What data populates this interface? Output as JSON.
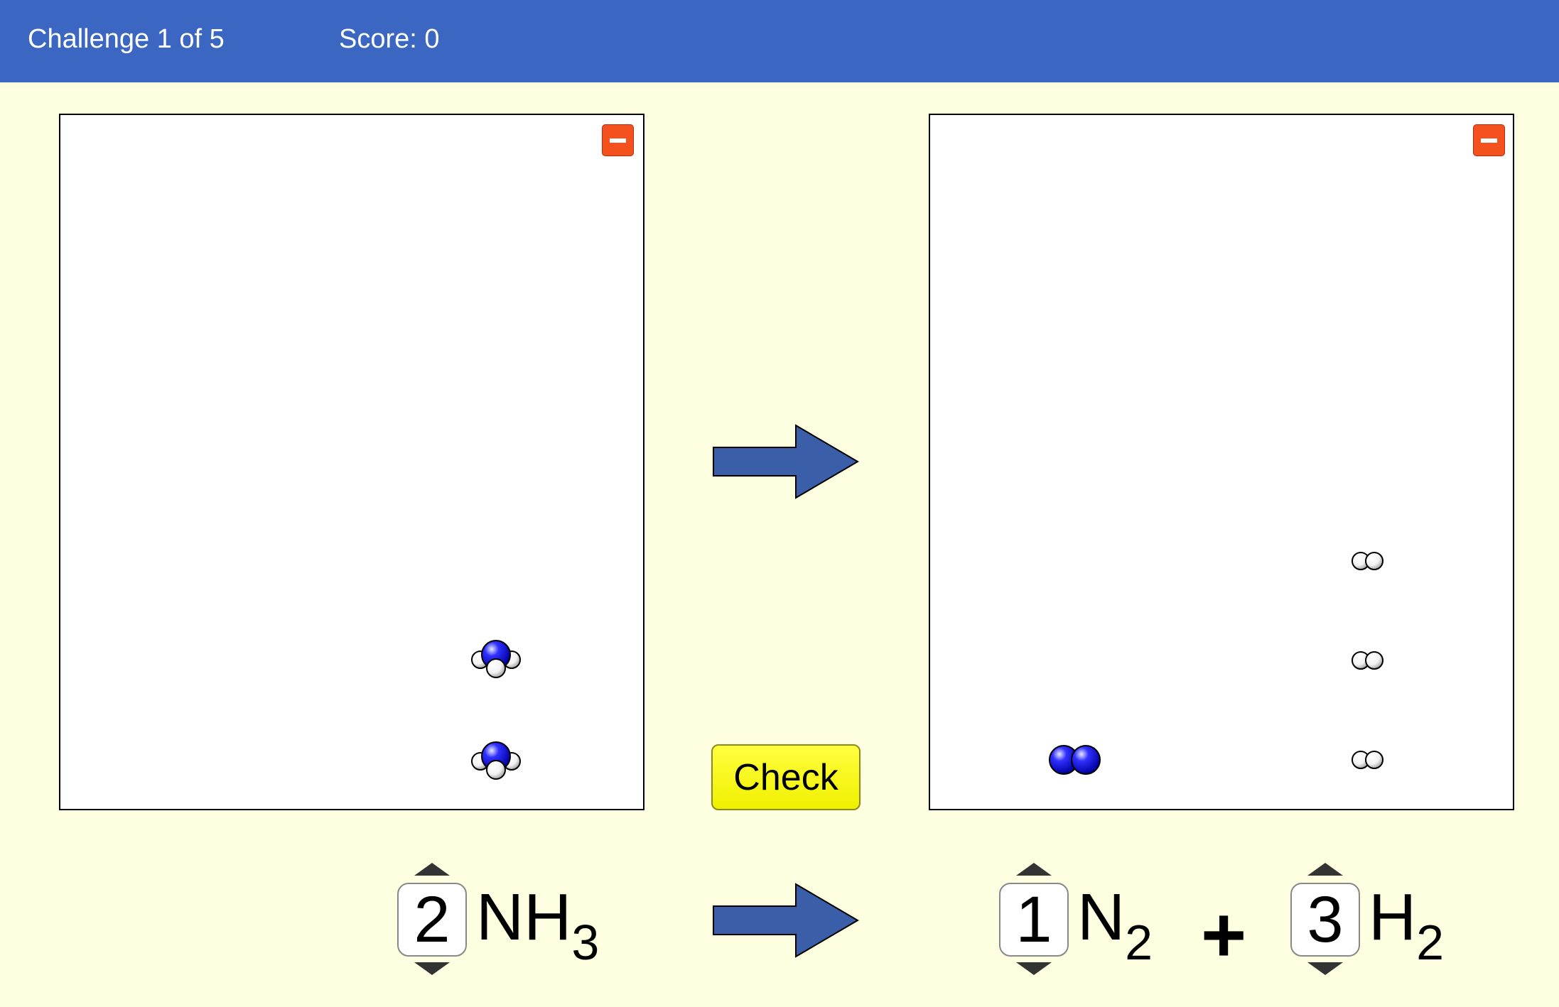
{
  "header": {
    "challenge": "Challenge 1 of 5",
    "score": "Score: 0"
  },
  "check_label": "Check",
  "colors": {
    "header": "#3b67c3",
    "background": "#fefee0",
    "arrow": "#3a5ea8",
    "minus": "#f4511e",
    "nitrogen": "#2020ff",
    "hydrogen": "#ffffff",
    "check": "#ffff30"
  },
  "equation": {
    "reactants": [
      {
        "coefficient": "2",
        "formula": "NH",
        "subscript": "3"
      }
    ],
    "products": [
      {
        "coefficient": "1",
        "formula": "N",
        "subscript": "2"
      },
      {
        "coefficient": "3",
        "formula": "H",
        "subscript": "2"
      }
    ],
    "plus": "+"
  },
  "reactant_box": {
    "molecules": [
      "NH3",
      "NH3"
    ]
  },
  "product_box": {
    "molecules": [
      "N2",
      "H2",
      "H2",
      "H2"
    ]
  }
}
